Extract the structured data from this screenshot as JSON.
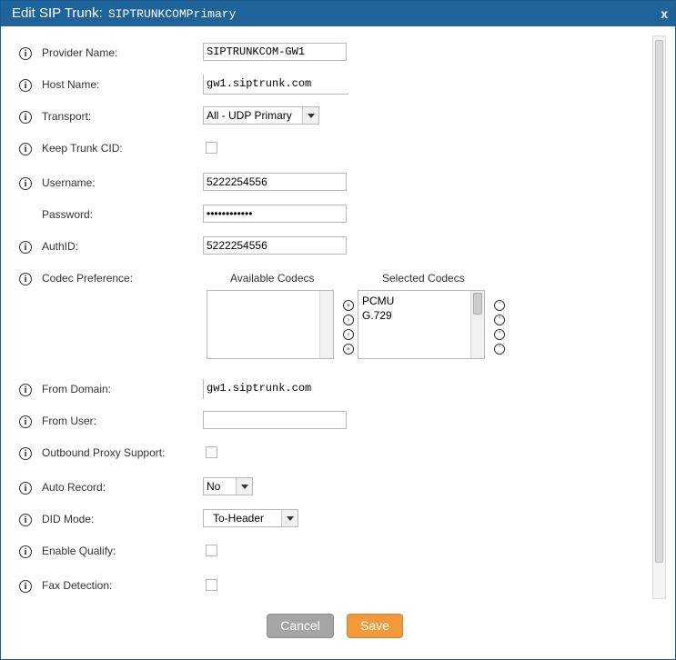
{
  "dialog": {
    "title_prefix": "Edit SIP Trunk:",
    "title_trunk": "SIPTRUNKCOMPrimary",
    "close_label": "x"
  },
  "icons": {
    "info_glyph": "i"
  },
  "form": {
    "provider_name": {
      "label": "Provider Name:",
      "value": "SIPTRUNKCOM-GW1"
    },
    "host_name": {
      "label": "Host Name:",
      "value": "gw1.siptrunk.com"
    },
    "transport": {
      "label": "Transport:",
      "value": "All - UDP Primary"
    },
    "keep_trunk_cid": {
      "label": "Keep Trunk CID:",
      "checked": false
    },
    "username": {
      "label": "Username:",
      "value": "5222254556"
    },
    "password": {
      "label": "Password:",
      "value": "••••••••••••"
    },
    "authid": {
      "label": "AuthID:",
      "value": "5222254556"
    },
    "codec_preference": {
      "label": "Codec Preference:",
      "available_header": "Available Codecs",
      "selected_header": "Selected Codecs",
      "available": [],
      "selected": [
        "PCMU",
        "G.729"
      ]
    },
    "from_domain": {
      "label": "From Domain:",
      "value": "gw1.siptrunk.com"
    },
    "from_user": {
      "label": "From User:",
      "value": ""
    },
    "outbound_proxy_support": {
      "label": "Outbound Proxy Support:",
      "checked": false
    },
    "auto_record": {
      "label": "Auto Record:",
      "value": "No"
    },
    "did_mode": {
      "label": "DID Mode:",
      "value": "To-Header"
    },
    "enable_qualify": {
      "label": "Enable Qualify:",
      "checked": false
    },
    "fax_detection": {
      "label": "Fax Detection:",
      "checked": false
    }
  },
  "buttons": {
    "cancel_label": "Cancel",
    "save_label": "Save"
  },
  "colors": {
    "titlebar": "#1f639b",
    "save_button": "#f19a3b",
    "cancel_button": "#a5a5a5"
  }
}
